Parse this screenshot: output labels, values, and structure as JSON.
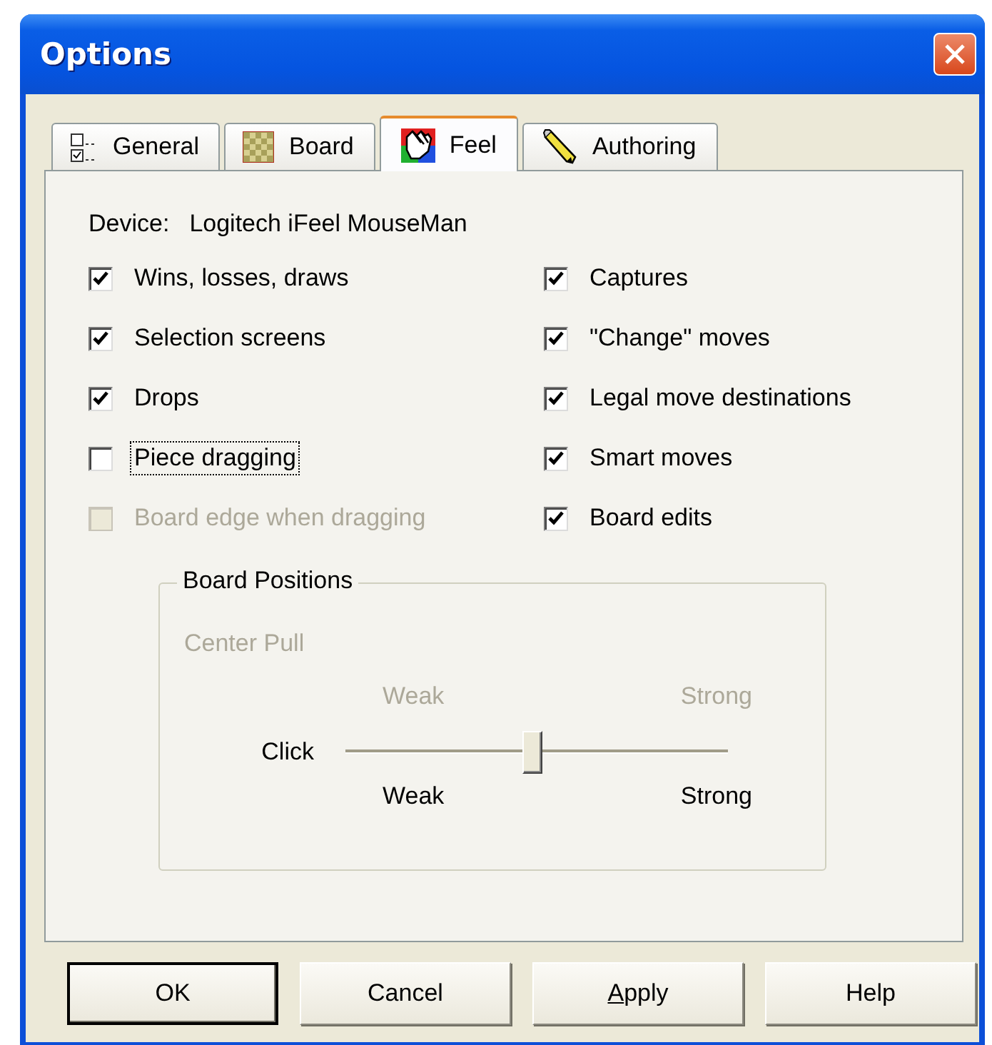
{
  "window": {
    "title": "Options"
  },
  "tabs": [
    {
      "label": "General",
      "kind": "general",
      "selected": false
    },
    {
      "label": "Board",
      "kind": "board",
      "selected": false
    },
    {
      "label": "Feel",
      "kind": "feel",
      "selected": true
    },
    {
      "label": "Authoring",
      "kind": "authoring",
      "selected": false
    }
  ],
  "device": {
    "label": "Device:",
    "value": "Logitech iFeel MouseMan"
  },
  "left_options": [
    {
      "label": "Wins, losses, draws",
      "checked": true,
      "disabled": false,
      "focused": false
    },
    {
      "label": "Selection screens",
      "checked": true,
      "disabled": false,
      "focused": false
    },
    {
      "label": "Drops",
      "checked": true,
      "disabled": false,
      "focused": false
    },
    {
      "label": "Piece dragging",
      "checked": false,
      "disabled": false,
      "focused": true
    },
    {
      "label": "Board edge when dragging",
      "checked": false,
      "disabled": true,
      "focused": false
    }
  ],
  "right_options": [
    {
      "label": "Captures",
      "checked": true,
      "disabled": false,
      "focused": false
    },
    {
      "label": "\"Change\" moves",
      "checked": true,
      "disabled": false,
      "focused": false
    },
    {
      "label": "Legal move destinations",
      "checked": true,
      "disabled": false,
      "focused": false
    },
    {
      "label": "Smart moves",
      "checked": true,
      "disabled": false,
      "focused": false
    },
    {
      "label": "Board edits",
      "checked": true,
      "disabled": false,
      "focused": false
    }
  ],
  "board_positions": {
    "title": "Board Positions",
    "sliders": [
      {
        "label": "Center Pull",
        "kind": "hidden",
        "min_label": "Weak",
        "max_label": "Strong"
      },
      {
        "label": "Click",
        "kind": "slider",
        "level": 0.49,
        "min_label": "Weak",
        "max_label": "Strong"
      }
    ]
  },
  "buttons": [
    {
      "label": "OK",
      "default": true,
      "mnemonic": false
    },
    {
      "label": "Cancel",
      "default": false,
      "mnemonic": false
    },
    {
      "label": "Apply",
      "default": false,
      "mnemonic": true
    },
    {
      "label": "Help",
      "default": false,
      "mnemonic": false
    }
  ]
}
